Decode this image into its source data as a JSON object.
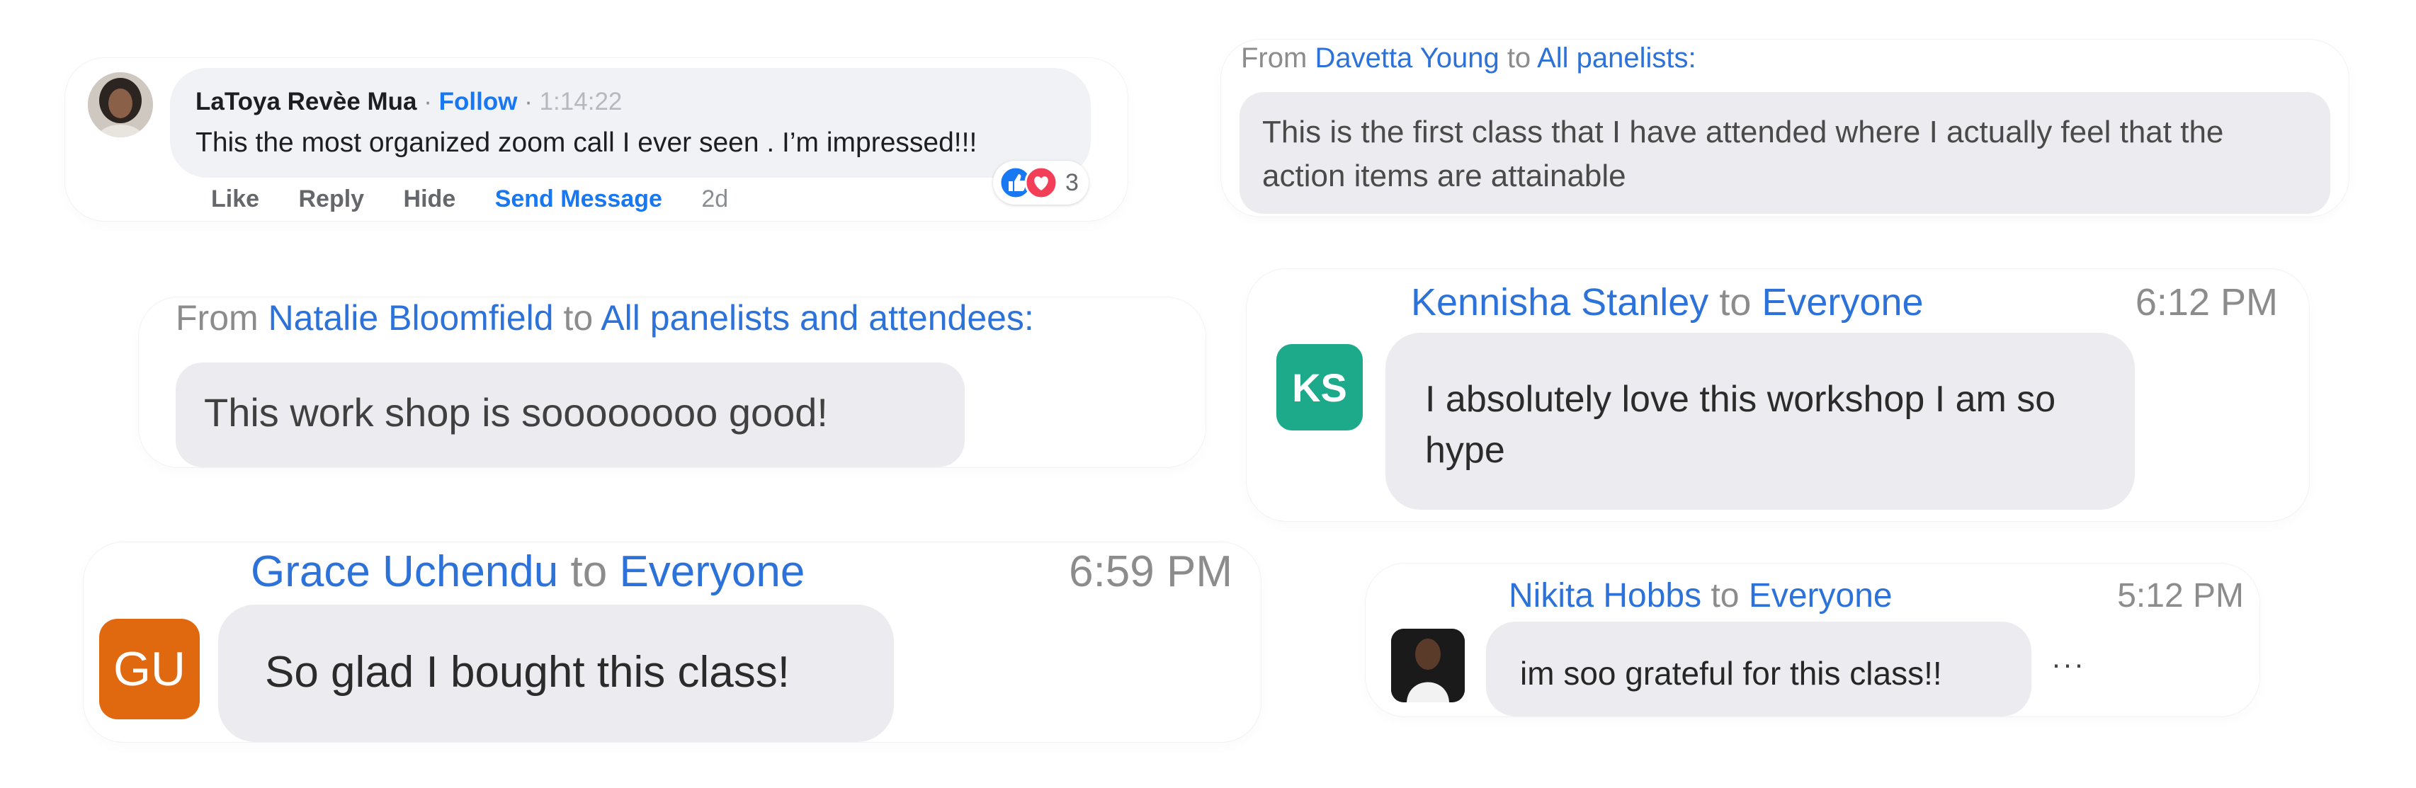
{
  "fb_comment": {
    "name": "LaToya Revèe Mua",
    "separator": "·",
    "follow_label": "Follow",
    "time": "1:14:22",
    "text": "This the most organized zoom call I ever seen . I’m impressed!!!",
    "actions": {
      "like": "Like",
      "reply": "Reply",
      "hide": "Hide",
      "send_message": "Send Message",
      "age": "2d"
    },
    "reaction_count": "3"
  },
  "davetta": {
    "from_word": "From",
    "name": "Davetta Young",
    "to_word": "to",
    "recipient": "All panelists:",
    "text": "This is the first class that I have attended where I actually feel that the action items are attainable"
  },
  "natalie": {
    "from_word": "From",
    "name": "Natalie Bloomfield",
    "to_word": "to",
    "recipient": "All panelists and attendees:",
    "text": "This work shop is soooooooo good!"
  },
  "kennisha": {
    "initials": "KS",
    "name": "Kennisha Stanley",
    "to_word": "to",
    "recipient": "Everyone",
    "time": "6:12 PM",
    "text": "I absolutely love this workshop I am so hype"
  },
  "grace": {
    "initials": "GU",
    "name": "Grace Uchendu",
    "to_word": "to",
    "recipient": "Everyone",
    "time": "6:59 PM",
    "text": "So glad I bought this class!"
  },
  "nikita": {
    "name": "Nikita Hobbs",
    "to_word": "to",
    "recipient": "Everyone",
    "time": "5:12 PM",
    "text": "im soo grateful for this class!!",
    "more": "···"
  },
  "colors": {
    "zoom_blue": "#2d72d9",
    "facebook_blue": "#1877f2",
    "bubble_grey": "#ebebf0",
    "ks_avatar": "#1caa8a",
    "gu_avatar": "#e0680f"
  }
}
